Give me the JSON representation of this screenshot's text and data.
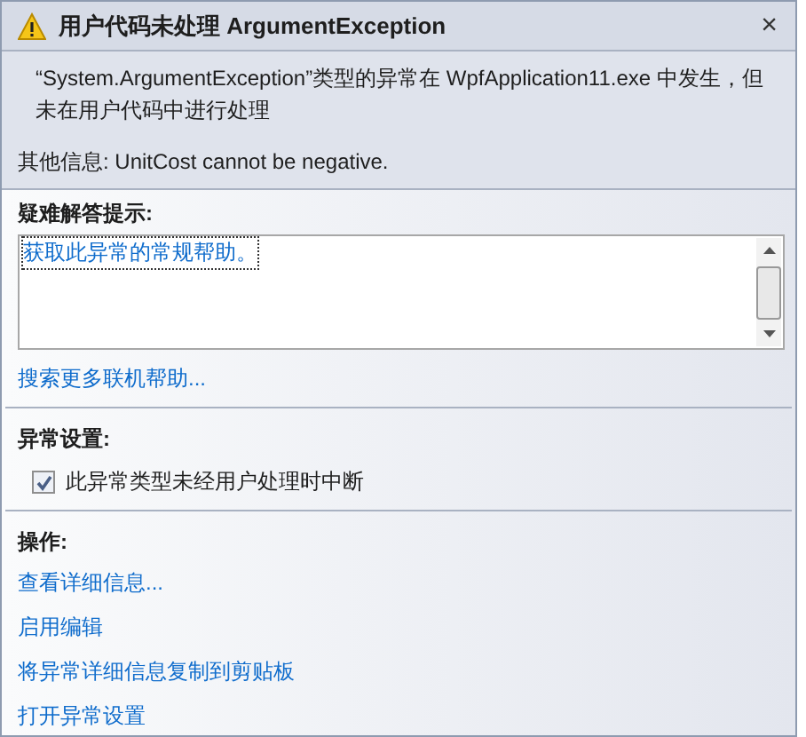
{
  "window": {
    "title": "用户代码未处理 ArgumentException",
    "close": "×"
  },
  "message": "“System.ArgumentException”类型的异常在 WpfApplication11.exe 中发生，但未在用户代码中进行处理",
  "details": "其他信息: UnitCost cannot be negative.",
  "troubleshooting": {
    "heading": "疑难解答提示:",
    "tips": [
      "获取此异常的常规帮助。"
    ],
    "search_link": "搜索更多联机帮助..."
  },
  "settings": {
    "heading": "异常设置:",
    "options": [
      {
        "label": "此异常类型未经用户处理时中断",
        "checked": true
      }
    ]
  },
  "actions": {
    "heading": "操作:",
    "links": [
      "查看详细信息...",
      "启用编辑",
      "将异常详细信息复制到剪贴板",
      "打开异常设置"
    ]
  }
}
